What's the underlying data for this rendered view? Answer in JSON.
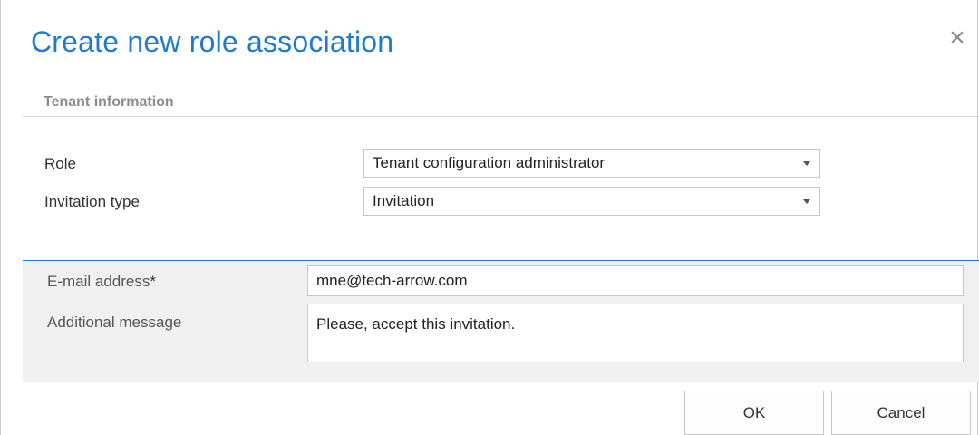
{
  "dialog": {
    "title": "Create new role association",
    "close_glyph": "×",
    "close_icon": "close-icon"
  },
  "tenant_section": {
    "title": "Tenant information",
    "role": {
      "label": "Role",
      "value": "Tenant configuration administrator",
      "icon": "chevron-down-icon"
    },
    "invitation_type": {
      "label": "Invitation type",
      "value": "Invitation",
      "icon": "chevron-down-icon"
    }
  },
  "invite_section": {
    "email": {
      "label": "E-mail address",
      "required_mark": "*",
      "value": "mne@tech-arrow.com"
    },
    "message": {
      "label": "Additional message",
      "value": "Please, accept this invitation."
    },
    "accent_color": "#2a78c8",
    "panel_color": "#f0f0f0"
  },
  "buttons": {
    "ok": "OK",
    "cancel": "Cancel"
  },
  "colors": {
    "title": "#1f7ad1",
    "section_title": "#8c8c8c"
  }
}
